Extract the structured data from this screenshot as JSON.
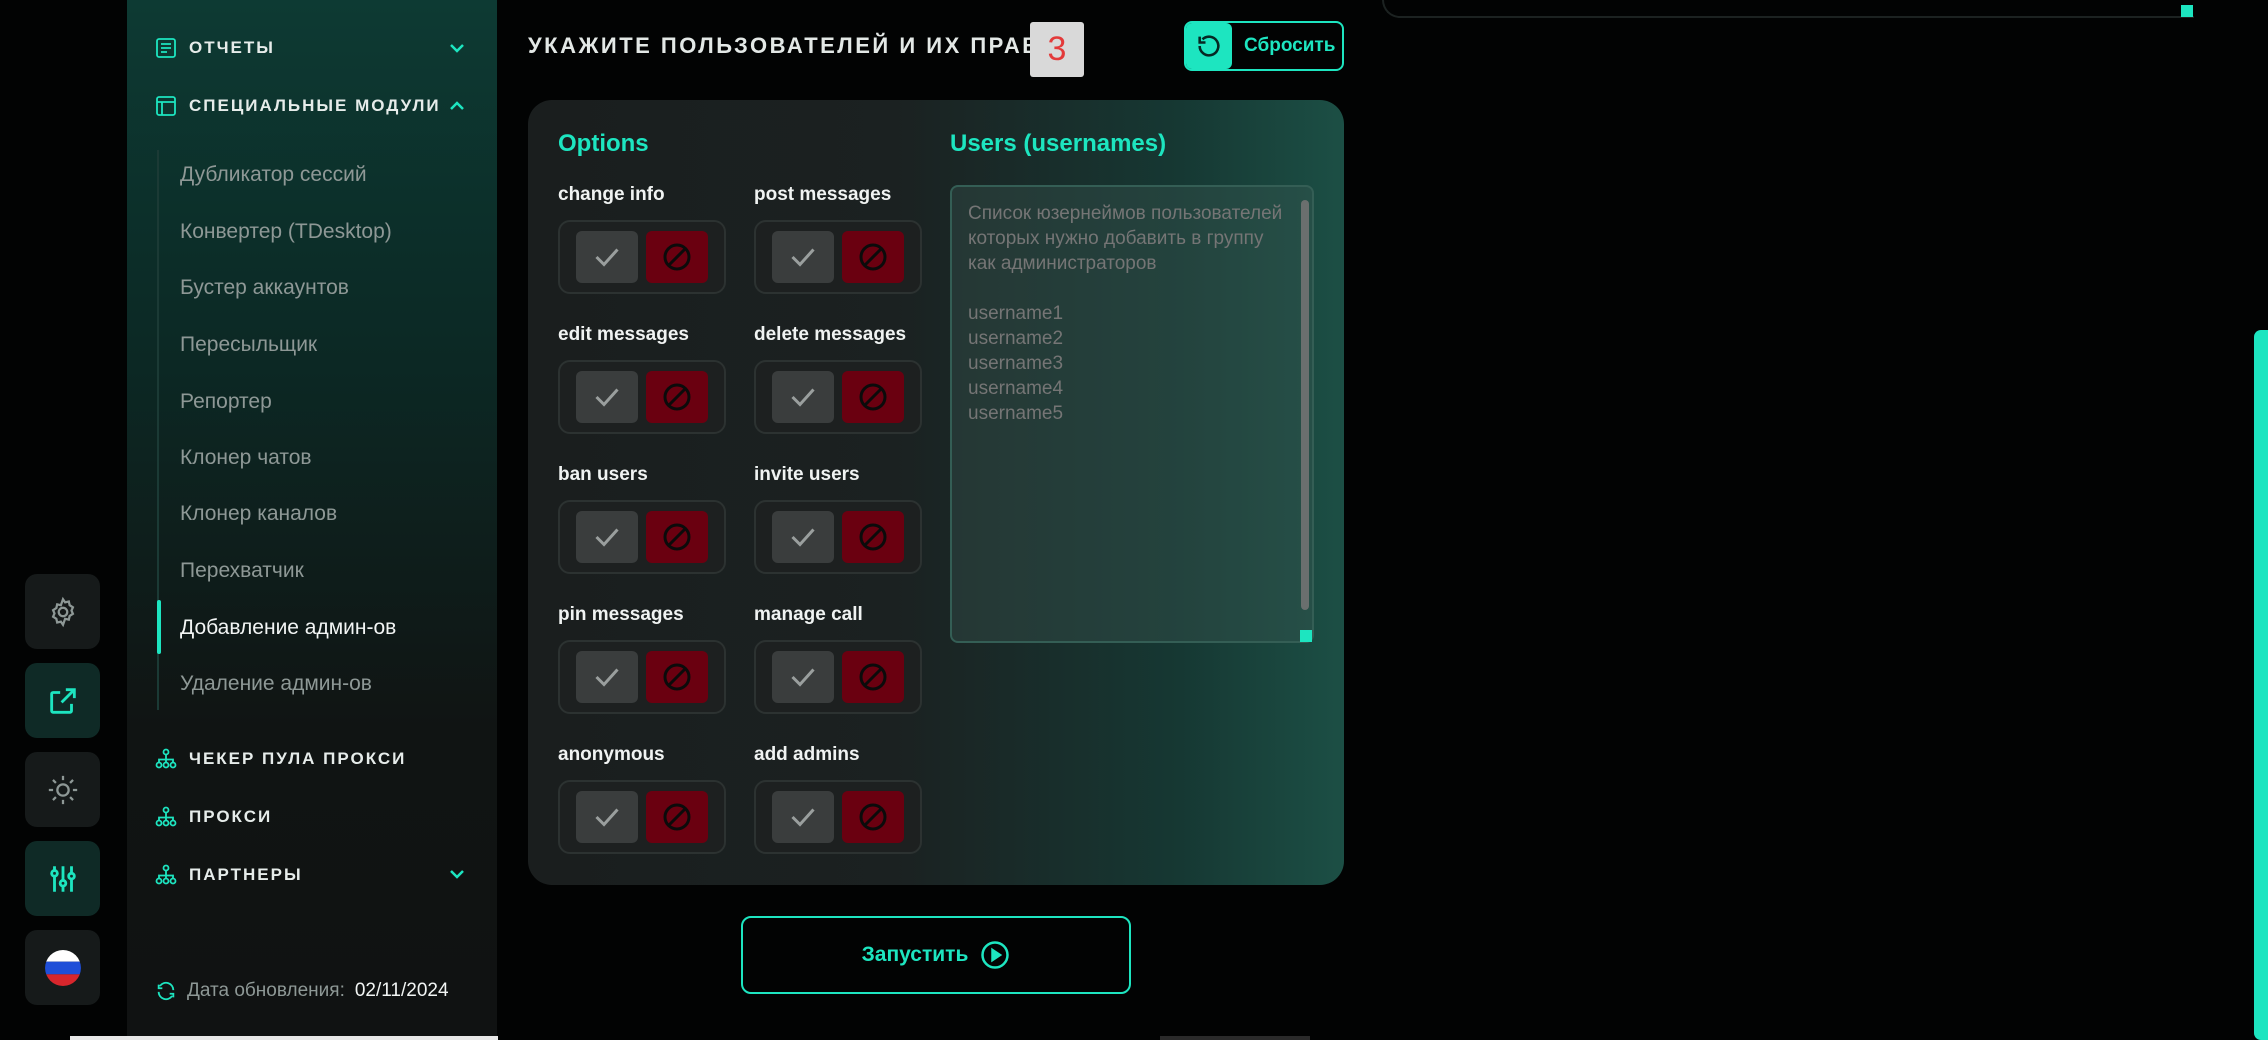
{
  "sidebar": {
    "sections": [
      {
        "label": "ОТЧЕТЫ",
        "icon": "report-icon",
        "chevron": "down"
      },
      {
        "label": "СПЕЦИАЛЬНЫЕ МОДУЛИ",
        "icon": "modules-icon",
        "chevron": "up"
      }
    ],
    "items": [
      "Дубликатор сессий",
      "Конвертер (TDesktop)",
      "Бустер аккаунтов",
      "Пересыльщик",
      "Репортер",
      "Клонер чатов",
      "Клонер каналов",
      "Перехватчик",
      "Добавление админ-ов",
      "Удаление админ-ов"
    ],
    "active_item": "Добавление админ-ов",
    "bottom_sections": [
      {
        "label": "ЧЕКЕР ПУЛА ПРОКСИ",
        "icon": "network-icon"
      },
      {
        "label": "ПРОКСИ",
        "icon": "network-icon"
      },
      {
        "label": "ПАРТНЕРЫ",
        "icon": "network-icon",
        "chevron": "down"
      }
    ],
    "update_label": "Дата обновления:",
    "update_date": "02/11/2024"
  },
  "rail": [
    "settings-icon",
    "external-link-icon",
    "theme-icon",
    "sliders-icon",
    "russia-flag-icon"
  ],
  "main": {
    "title": "УКАЖИТЕ ПОЛЬЗОВАТЕЛЕЙ И ИХ ПРАВА",
    "count": "3",
    "reset_label": "Сбросить",
    "options_heading": "Options",
    "users_heading": "Users (usernames)",
    "permissions": [
      "change info",
      "post messages",
      "edit messages",
      "delete messages",
      "ban users",
      "invite users",
      "pin messages",
      "manage call",
      "anonymous",
      "add admins"
    ],
    "users_placeholder": "Список юзернеймов пользователей которых нужно добавить в группу как администраторов\n\nusername1\nusername2\nusername3\nusername4\nusername5",
    "run_label": "Запустить"
  },
  "colors": {
    "accent": "#1de5c0",
    "deny": "#6a0010",
    "badge_text": "#e33a3a"
  }
}
